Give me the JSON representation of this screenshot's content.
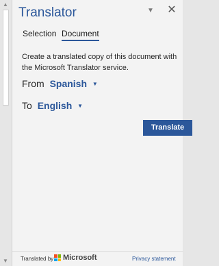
{
  "pane": {
    "title": "Translator",
    "options_icon": "chevron-down-icon",
    "close_glyph": "✕"
  },
  "tabs": [
    {
      "label": "Selection",
      "active": false
    },
    {
      "label": "Document",
      "active": true
    }
  ],
  "description": "Create a translated copy of this document with the Microsoft Translator service.",
  "from": {
    "label": "From",
    "value": "Spanish"
  },
  "to": {
    "label": "To",
    "value": "English"
  },
  "translate_button": {
    "label": "Translate"
  },
  "footer": {
    "translated_by": "Translated by",
    "brand": "Microsoft",
    "privacy_link": "Privacy statement"
  },
  "colors": {
    "accent": "#2b579a",
    "pane_background": "#f3f3f3"
  }
}
